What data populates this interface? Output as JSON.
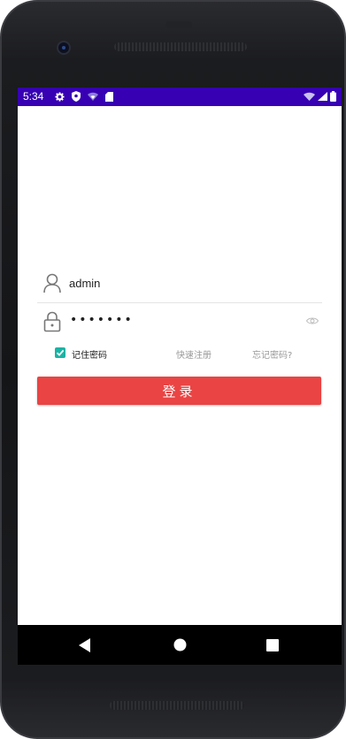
{
  "status_bar": {
    "time": "5:34",
    "left_icons": [
      "settings-icon",
      "shield-icon",
      "wifi-off-icon",
      "sd-card-icon"
    ],
    "right_icons": [
      "wifi-icon",
      "signal-icon",
      "battery-icon"
    ],
    "color": "#3700b3"
  },
  "login": {
    "username_value": "admin",
    "password_masked": "•••••••",
    "remember_label": "记住密码",
    "remember_checked": true,
    "register_label": "快速注册",
    "forgot_label": "忘记密码?",
    "login_button_label": "登录",
    "accent_color": "#ea4444",
    "checkbox_color": "#1bb3a4"
  },
  "nav_bar": {
    "buttons": [
      "back-icon",
      "home-icon",
      "recents-icon"
    ]
  }
}
